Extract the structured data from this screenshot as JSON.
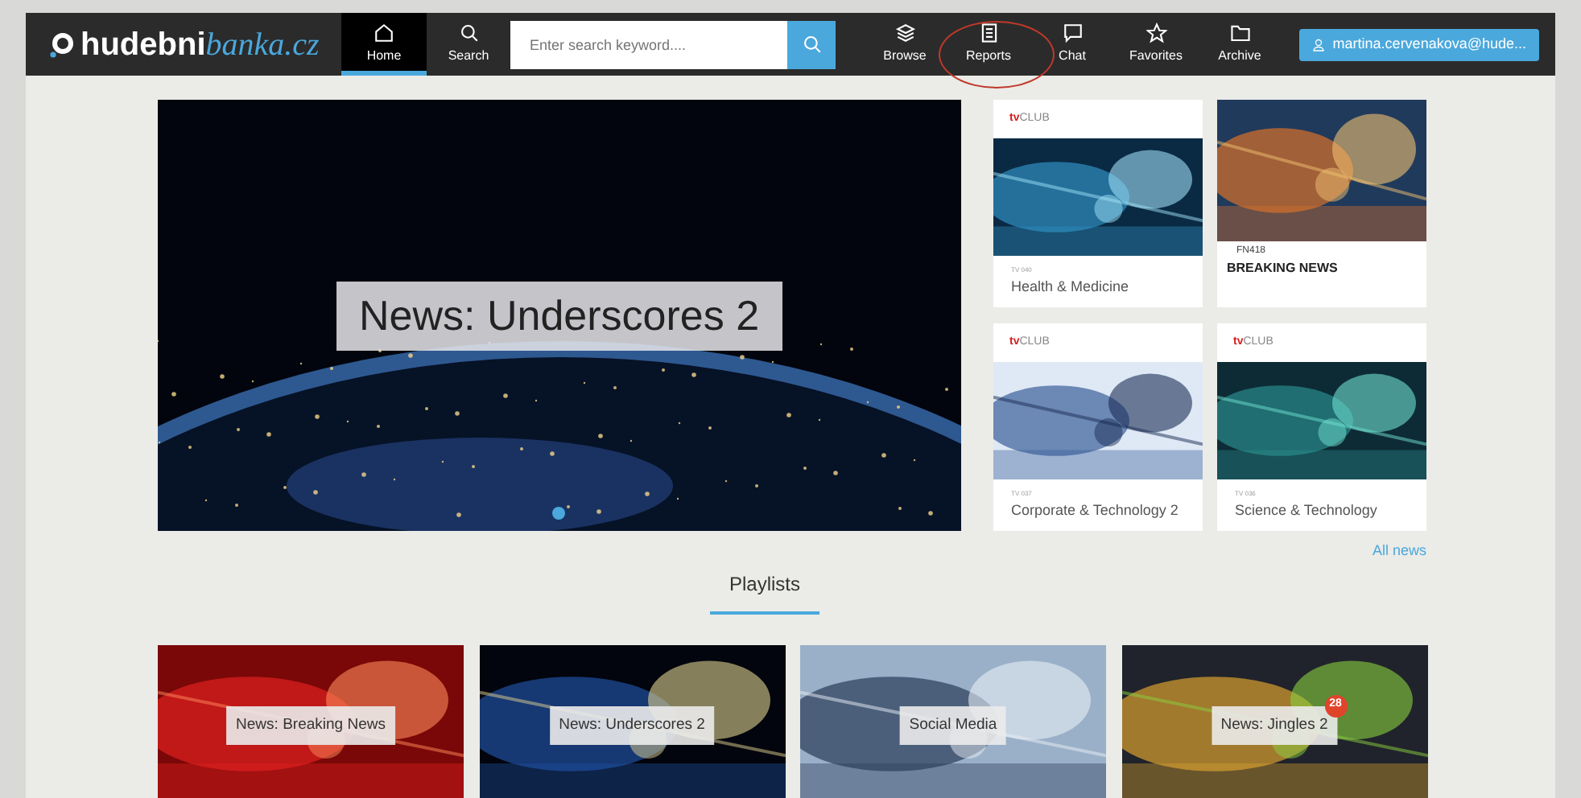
{
  "brand": {
    "name": "hudebni",
    "accent": "banka.cz"
  },
  "nav_left": [
    {
      "label": "Home",
      "selected": true,
      "highlighted": false
    },
    {
      "label": "Search",
      "selected": false,
      "highlighted": false
    }
  ],
  "search": {
    "placeholder": "Enter search keyword...."
  },
  "nav_right": [
    {
      "label": "Browse",
      "selected": false,
      "highlighted": false
    },
    {
      "label": "Reports",
      "selected": false,
      "highlighted": true
    },
    {
      "label": "Chat",
      "selected": false,
      "highlighted": false
    },
    {
      "label": "Favorites",
      "selected": false,
      "highlighted": false
    },
    {
      "label": "Archive",
      "selected": false,
      "highlighted": false
    }
  ],
  "user": {
    "label": "martina.cervenakova@hude..."
  },
  "hero": {
    "title": "News: Underscores 2",
    "slides": [
      {
        "selected": true
      }
    ]
  },
  "news_cards": [
    {
      "kind": "club",
      "logo": "tv",
      "logo_suffix": "CLUB",
      "code": "TV 040",
      "title": "Health & Medicine"
    },
    {
      "kind": "cover",
      "code": "FN418",
      "title": "BREAKING NEWS"
    },
    {
      "kind": "club",
      "logo": "tv",
      "logo_suffix": "CLUB",
      "code": "TV 037",
      "title": "Corporate & Technology 2"
    },
    {
      "kind": "club",
      "logo": "tv",
      "logo_suffix": "CLUB",
      "code": "TV 036",
      "title": "Science & Technology"
    }
  ],
  "all_news": "All news",
  "section_title": "Playlists",
  "playlists": [
    {
      "title": "News: Breaking News"
    },
    {
      "title": "News: Underscores 2"
    },
    {
      "title": "Social Media"
    },
    {
      "title": "News: Jingles 2",
      "badge": "28"
    }
  ]
}
